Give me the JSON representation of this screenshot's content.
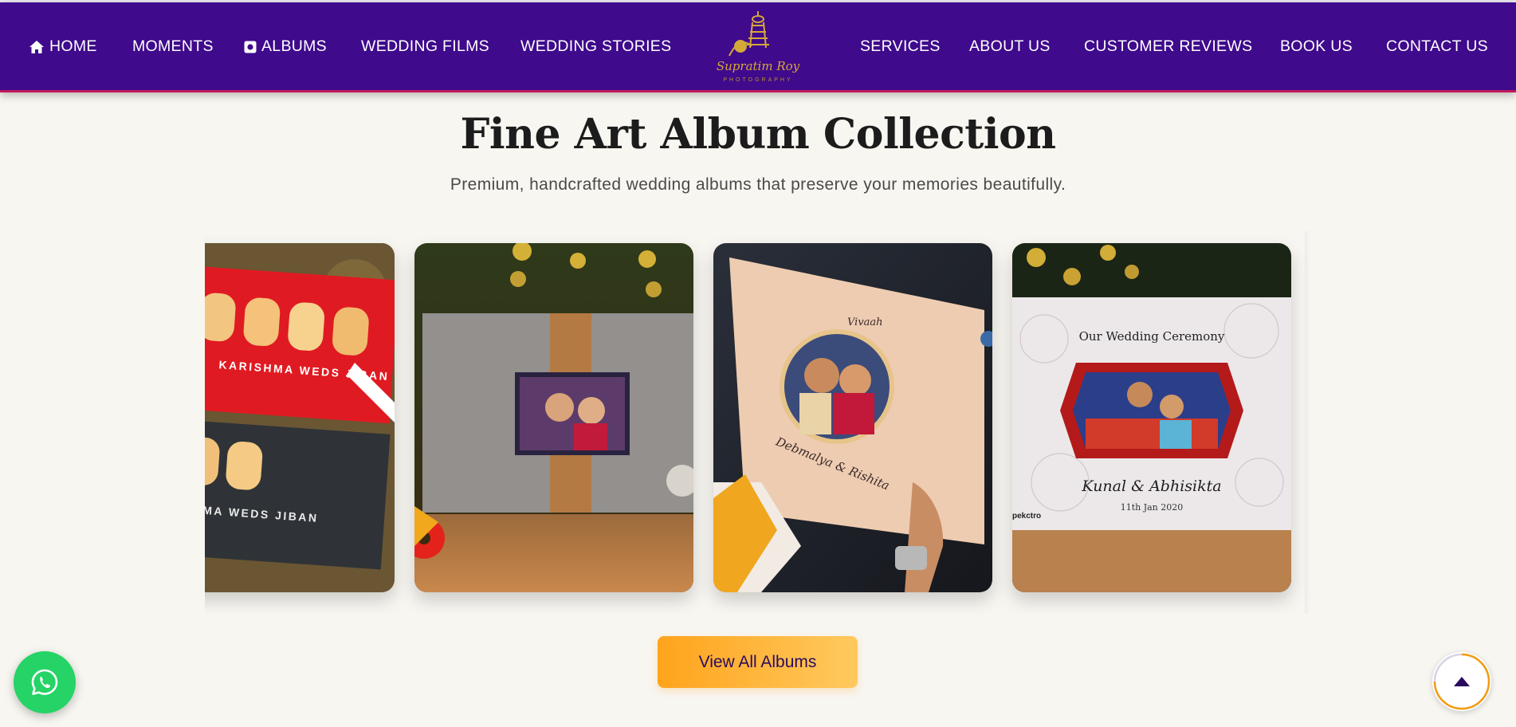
{
  "nav": {
    "items": [
      {
        "label": "HOME",
        "icon": "home-icon"
      },
      {
        "label": "MOMENTS"
      },
      {
        "label": "ALBUMS",
        "icon": "album-icon"
      },
      {
        "label": "WEDDING FILMS"
      },
      {
        "label": "WEDDING STORIES"
      },
      {
        "label": "SERVICES"
      },
      {
        "label": "ABOUT US"
      },
      {
        "label": "CUSTOMER REVIEWS"
      },
      {
        "label": "BOOK US"
      },
      {
        "label": "CONTACT US"
      }
    ],
    "logo": {
      "script": "Supratim Roy",
      "sub": "PHOTOGRAPHY"
    }
  },
  "section": {
    "title": "Fine Art Album Collection",
    "subtitle": "Premium, handcrafted wedding albums that preserve your memories beautifully."
  },
  "albums": [
    {
      "cover_text": "KARISHMA WEDS JIBAN",
      "cover_text_2": "MA WEDS JIBAN"
    },
    {
      "cover_text": ""
    },
    {
      "cover_text": "Vivaah",
      "names": "Debmalya & Rishita"
    },
    {
      "heading": "Our Wedding Ceremony",
      "names": "Kunal & Abhisikta",
      "date": "11th Jan 2020",
      "brand": "pekctro"
    }
  ],
  "cta": {
    "label": "View All Albums"
  },
  "floating": {
    "whatsapp": "whatsapp-icon",
    "scroll_top": "arrow-up-icon"
  },
  "colors": {
    "nav_bg": "#3f0a8c",
    "accent": "#ffa41c",
    "nav_border": "#c2185b",
    "whatsapp": "#25d366"
  }
}
